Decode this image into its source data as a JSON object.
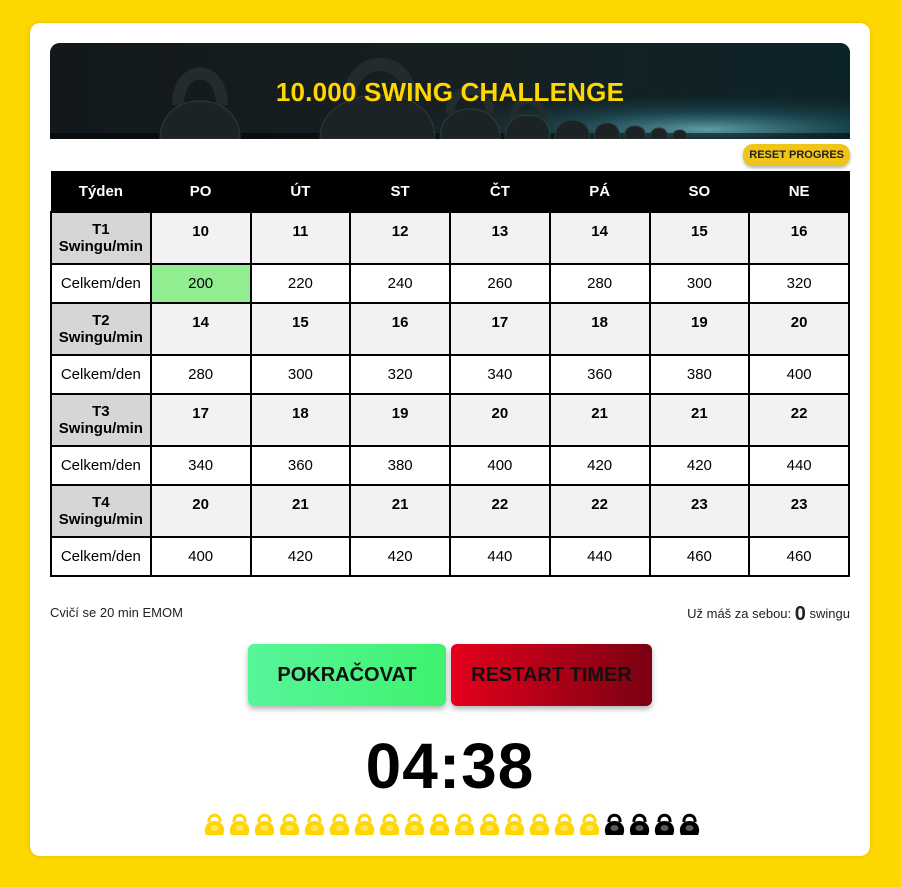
{
  "banner": {
    "title": "10.000 SWING CHALLENGE"
  },
  "reset_label": "RESET PROGRES",
  "table": {
    "headers": [
      "Týden",
      "PO",
      "ÚT",
      "ST",
      "ČT",
      "PÁ",
      "SO",
      "NE"
    ],
    "total_label": "Celkem/den",
    "weeks": [
      {
        "label_top": "T1",
        "label_bottom": "Swingu/min",
        "swings": [
          "10",
          "11",
          "12",
          "13",
          "14",
          "15",
          "16"
        ],
        "totals": [
          "200",
          "220",
          "240",
          "260",
          "280",
          "300",
          "320"
        ]
      },
      {
        "label_top": "T2",
        "label_bottom": "Swingu/min",
        "swings": [
          "14",
          "15",
          "16",
          "17",
          "18",
          "19",
          "20"
        ],
        "totals": [
          "280",
          "300",
          "320",
          "340",
          "360",
          "380",
          "400"
        ]
      },
      {
        "label_top": "T3",
        "label_bottom": "Swingu/min",
        "swings": [
          "17",
          "18",
          "19",
          "20",
          "21",
          "21",
          "22"
        ],
        "totals": [
          "340",
          "360",
          "380",
          "400",
          "420",
          "420",
          "440"
        ]
      },
      {
        "label_top": "T4",
        "label_bottom": "Swingu/min",
        "swings": [
          "20",
          "21",
          "21",
          "22",
          "22",
          "23",
          "23"
        ],
        "totals": [
          "400",
          "420",
          "420",
          "440",
          "440",
          "460",
          "460"
        ]
      }
    ]
  },
  "completed_day": {
    "week": 1,
    "day": "PO",
    "color": "#90ee90"
  },
  "note": "Cvičí se 20 min EMOM",
  "counter": {
    "prefix": "Už máš za sebou:",
    "value": "0",
    "suffix": "swingu"
  },
  "buttons": {
    "continue": "POKRAČOVAT",
    "restart": "RESTART TIMER"
  },
  "timer": "04:38",
  "progress": {
    "total": 20,
    "done": 16,
    "done_color": "#ffd700",
    "remaining_color": "#000000",
    "icon": "kettlebell-icon"
  },
  "colors": {
    "background": "#ffd700",
    "accent": "#ffd700",
    "header": "#000000",
    "continue": "#4cf07f",
    "restart": "#c8001a"
  }
}
